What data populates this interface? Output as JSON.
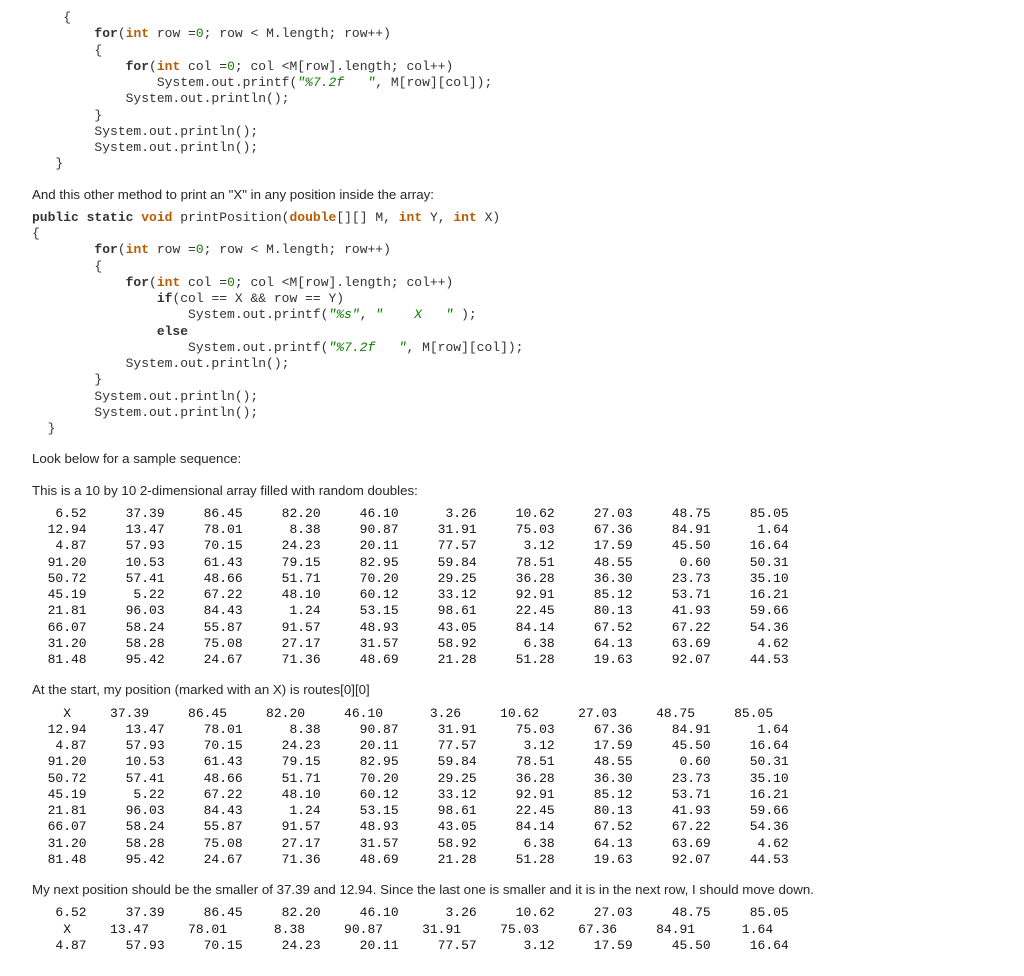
{
  "code_block_1": [
    {
      "t": "plain",
      "s": "    {"
    },
    {
      "t": "loop1",
      "s": "        for(int row =0; row < M.length; row++)"
    },
    {
      "t": "plain",
      "s": "        {"
    },
    {
      "t": "loop2",
      "s": "            for(int col = 0; col <M[row].length; col++)"
    },
    {
      "t": "printf1",
      "s": "                System.out.printf(\"%7.2f   \", M[row][col]);"
    },
    {
      "t": "plain",
      "s": "            System.out.println();"
    },
    {
      "t": "plain",
      "s": "        }"
    },
    {
      "t": "plain",
      "s": "        System.out.println();"
    },
    {
      "t": "plain",
      "s": "        System.out.println();"
    },
    {
      "t": "plain",
      "s": "   }"
    }
  ],
  "para_1": "And this other method to print an \"X\" in any position inside the array:",
  "code_block_2": [
    {
      "t": "sig",
      "s": "public static void printPosition(double[][] M, int Y, int X)"
    },
    {
      "t": "plain",
      "s": "{"
    },
    {
      "t": "loop1",
      "s": "        for(int row =0; row < M.length; row++)"
    },
    {
      "t": "plain",
      "s": "        {"
    },
    {
      "t": "loop2",
      "s": "            for(int col = 0; col <M[row].length; col++)"
    },
    {
      "t": "if",
      "s": "                if(col == X && row == Y)"
    },
    {
      "t": "printf2",
      "s": "                    System.out.printf(\"%s\", \"    X   \" );"
    },
    {
      "t": "else",
      "s": "                else"
    },
    {
      "t": "printf1",
      "s": "                    System.out.printf(\"%7.2f   \", M[row][col]);"
    },
    {
      "t": "plain",
      "s": "            System.out.println();"
    },
    {
      "t": "plain",
      "s": "        }"
    },
    {
      "t": "plain",
      "s": "        System.out.println();"
    },
    {
      "t": "plain",
      "s": "        System.out.println();"
    },
    {
      "t": "plain",
      "s": "  }"
    }
  ],
  "para_2": "Look below for a sample sequence:",
  "para_3": "This is a 10 by 10 2-dimensional array filled with random doubles:",
  "grid_data": [
    [
      6.52,
      37.39,
      86.45,
      82.2,
      46.1,
      3.26,
      10.62,
      27.03,
      48.75,
      85.05
    ],
    [
      12.94,
      13.47,
      78.01,
      8.38,
      90.87,
      31.91,
      75.03,
      67.36,
      84.91,
      1.64
    ],
    [
      4.87,
      57.93,
      70.15,
      24.23,
      20.11,
      77.57,
      3.12,
      17.59,
      45.5,
      16.64
    ],
    [
      91.2,
      10.53,
      61.43,
      79.15,
      82.95,
      59.84,
      78.51,
      48.55,
      0.6,
      50.31
    ],
    [
      50.72,
      57.41,
      48.66,
      51.71,
      70.2,
      29.25,
      36.28,
      36.3,
      23.73,
      35.1
    ],
    [
      45.19,
      5.22,
      67.22,
      48.1,
      60.12,
      33.12,
      92.91,
      85.12,
      53.71,
      16.21
    ],
    [
      21.81,
      96.03,
      84.43,
      1.24,
      53.15,
      98.61,
      22.45,
      80.13,
      41.93,
      59.66
    ],
    [
      66.07,
      58.24,
      55.87,
      91.57,
      48.93,
      43.05,
      84.14,
      67.52,
      67.22,
      54.36
    ],
    [
      31.2,
      58.28,
      75.08,
      27.17,
      31.57,
      58.92,
      6.38,
      64.13,
      63.69,
      4.62
    ],
    [
      81.48,
      95.42,
      24.67,
      71.36,
      48.69,
      21.28,
      51.28,
      19.63,
      92.07,
      44.53
    ]
  ],
  "para_4": "At the start, my position (marked with an X) is routes[0][0]",
  "mark_1": {
    "row": 0,
    "col": 0
  },
  "para_5": "My next position should be the smaller of 37.39 and 12.94. Since the last one is smaller and it is in the next row, I should move down.",
  "mark_2": {
    "row": 1,
    "col": 0
  },
  "partial_rows_2": 3
}
